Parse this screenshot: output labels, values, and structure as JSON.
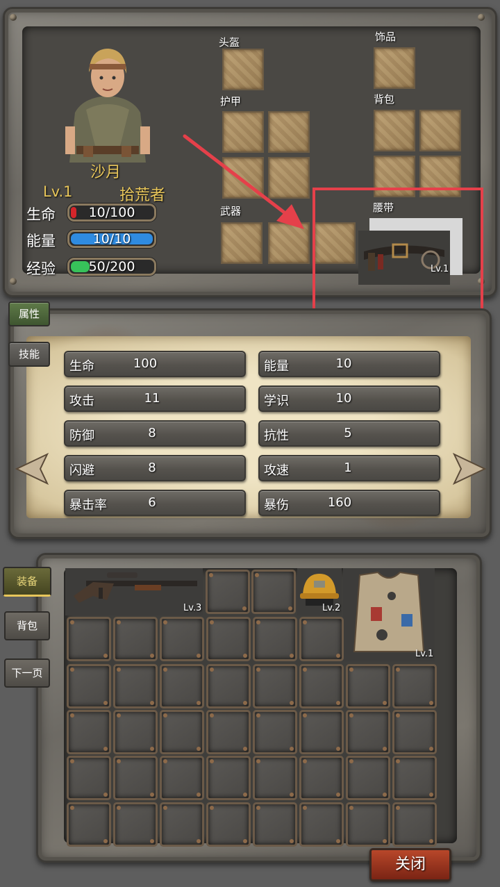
{
  "character": {
    "name": "沙月",
    "level": "Lv.1",
    "profession": "拾荒者",
    "bars": [
      {
        "label": "生命",
        "text": "10/100",
        "fill": 0.1,
        "color": "#d4252a"
      },
      {
        "label": "能量",
        "text": "10/10",
        "fill": 1.0,
        "color": "#2f8be0"
      },
      {
        "label": "经验",
        "text": "50/200",
        "fill": 0.25,
        "color": "#37c25a"
      }
    ]
  },
  "equipment": {
    "helmet_label": "头盔",
    "accessory_label": "饰品",
    "armor_label": "护甲",
    "backpack_label": "背包",
    "weapon_label": "武器",
    "belt_label": "腰带",
    "belt_level": "Lv.1"
  },
  "side_tabs": {
    "attributes": "属性",
    "skills": "技能"
  },
  "stats": {
    "left": [
      {
        "name": "生命",
        "value": "100"
      },
      {
        "name": "攻击",
        "value": "11"
      },
      {
        "name": "防御",
        "value": "8"
      },
      {
        "name": "闪避",
        "value": "8"
      },
      {
        "name": "暴击率",
        "value": "6"
      }
    ],
    "right": [
      {
        "name": "能量",
        "value": "10"
      },
      {
        "name": "学识",
        "value": "10"
      },
      {
        "name": "抗性",
        "value": "5"
      },
      {
        "name": "攻速",
        "value": "1"
      },
      {
        "name": "暴伤",
        "value": "160"
      }
    ]
  },
  "inventory": {
    "tabs": {
      "equip": "装备",
      "bag": "背包",
      "next": "下一页"
    },
    "items": [
      {
        "name": "rifle",
        "level": "Lv.3"
      },
      {
        "name": "hard-hat",
        "level": "Lv.2"
      },
      {
        "name": "vest",
        "level": "Lv.1"
      }
    ]
  },
  "close_button": "关闭",
  "colors": {
    "gold": "#e8c65a",
    "highlight": "#e5404a"
  }
}
